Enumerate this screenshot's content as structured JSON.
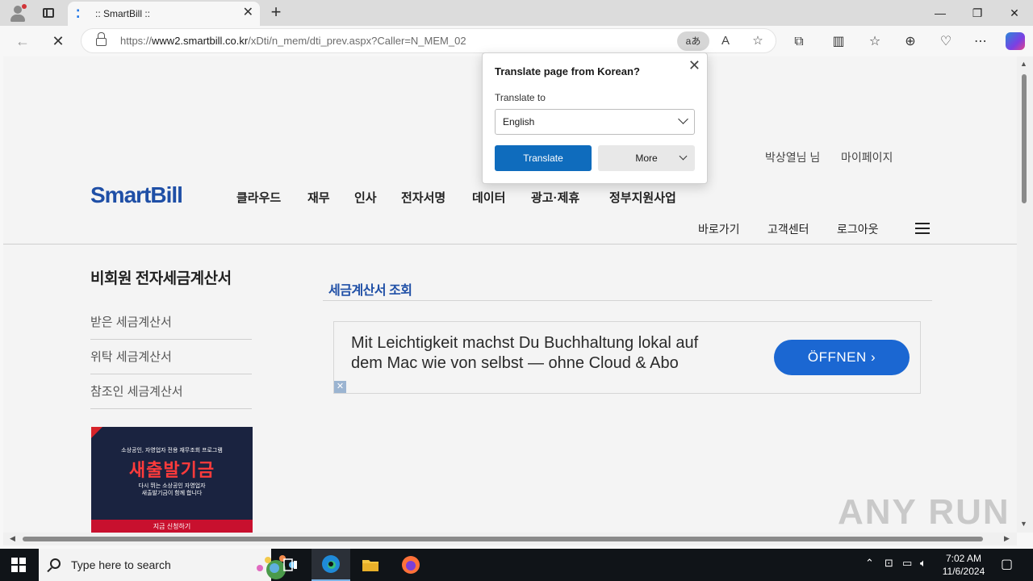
{
  "browser": {
    "tab_title": ":: SmartBill ::",
    "favicon": "⁚",
    "url_prefix": "https://",
    "url_host": "www2.smartbill.co.kr",
    "url_path": "/xDti/n_mem/dti_prev.aspx?Caller=N_MEM_02",
    "translate_chip": "aあ",
    "new_tab_symbol": "+",
    "tab_close_symbol": "✕",
    "window_controls": {
      "minimize": "—",
      "restore": "❐",
      "close": "✕"
    },
    "icons": [
      "back-arrow-icon",
      "stop-loading-icon",
      "read-aloud-icon",
      "favorite-star-icon",
      "extensions-icon",
      "split-screen-icon",
      "favorites-icon",
      "collections-icon",
      "browser-essentials-icon",
      "more-icon",
      "copilot-icon"
    ]
  },
  "translate_popup": {
    "title": "Translate page from Korean?",
    "label": "Translate to",
    "selected_language": "English",
    "translate_button": "Translate",
    "more_button": "More"
  },
  "site": {
    "logo": "SmartBill",
    "user_links": [
      "박상열님 님",
      "마이페이지"
    ],
    "gnb": [
      "클라우드",
      "재무",
      "인사",
      "전자서명",
      "데이터",
      "광고·제휴",
      "정부지원사업"
    ],
    "sub_links": [
      "바로가기",
      "고객센터",
      "로그아웃"
    ],
    "sidebar_title": "비회원 전자세금계산서",
    "sidebar_items": [
      "받은 세금계산서",
      "위탁 세금계산서",
      "참조인 세금계산서"
    ],
    "banner": {
      "top_line": "소상공인, 자영업자 전용 재무조회 프로그램",
      "headline": "새출발기금",
      "sub_line1": "다시 뛰는 소상공인 자영업자",
      "sub_line2": "새출발기금이 함께 합니다",
      "cta": "지금 신청하기"
    },
    "content_title": "세금계산서 조회",
    "ad": {
      "line1": "Mit Leichtigkeit machst Du Buchhaltung lokal auf",
      "line2": "dem Mac wie von selbst — ohne Cloud & Abo",
      "button": "ÖFFNEN",
      "close": "✕"
    },
    "watermark": "ANY RUN"
  },
  "taskbar": {
    "search_placeholder": "Type here to search",
    "time": "7:02 AM",
    "date": "11/6/2024"
  },
  "colors": {
    "brand_blue": "#1f4fa6",
    "translate_button": "#0f6cbd",
    "ad_button": "#1b67d2",
    "banner_red": "#ff3b3b"
  }
}
